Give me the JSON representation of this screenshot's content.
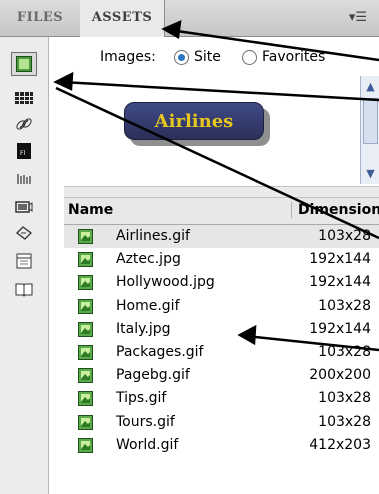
{
  "tabs": {
    "files": "FILES",
    "assets": "ASSETS"
  },
  "images_row": {
    "label": "Images:",
    "site": "Site",
    "favorites": "Favorites"
  },
  "preview": {
    "button_text": "Airlines"
  },
  "list": {
    "columns": {
      "name": "Name",
      "dimensions": "Dimensions"
    },
    "rows": [
      {
        "name": "Airlines.gif",
        "dim": "103x28"
      },
      {
        "name": "Aztec.jpg",
        "dim": "192x144"
      },
      {
        "name": "Hollywood.jpg",
        "dim": "192x144"
      },
      {
        "name": "Home.gif",
        "dim": "103x28"
      },
      {
        "name": "Italy.jpg",
        "dim": "192x144"
      },
      {
        "name": "Packages.gif",
        "dim": "103x28"
      },
      {
        "name": "Pagebg.gif",
        "dim": "200x200"
      },
      {
        "name": "Tips.gif",
        "dim": "103x28"
      },
      {
        "name": "Tours.gif",
        "dim": "103x28"
      },
      {
        "name": "World.gif",
        "dim": "412x203"
      }
    ]
  },
  "colors": {
    "accent": "#2a76c6",
    "button_bg": "#3f4a86",
    "button_text": "#e6c61e"
  }
}
